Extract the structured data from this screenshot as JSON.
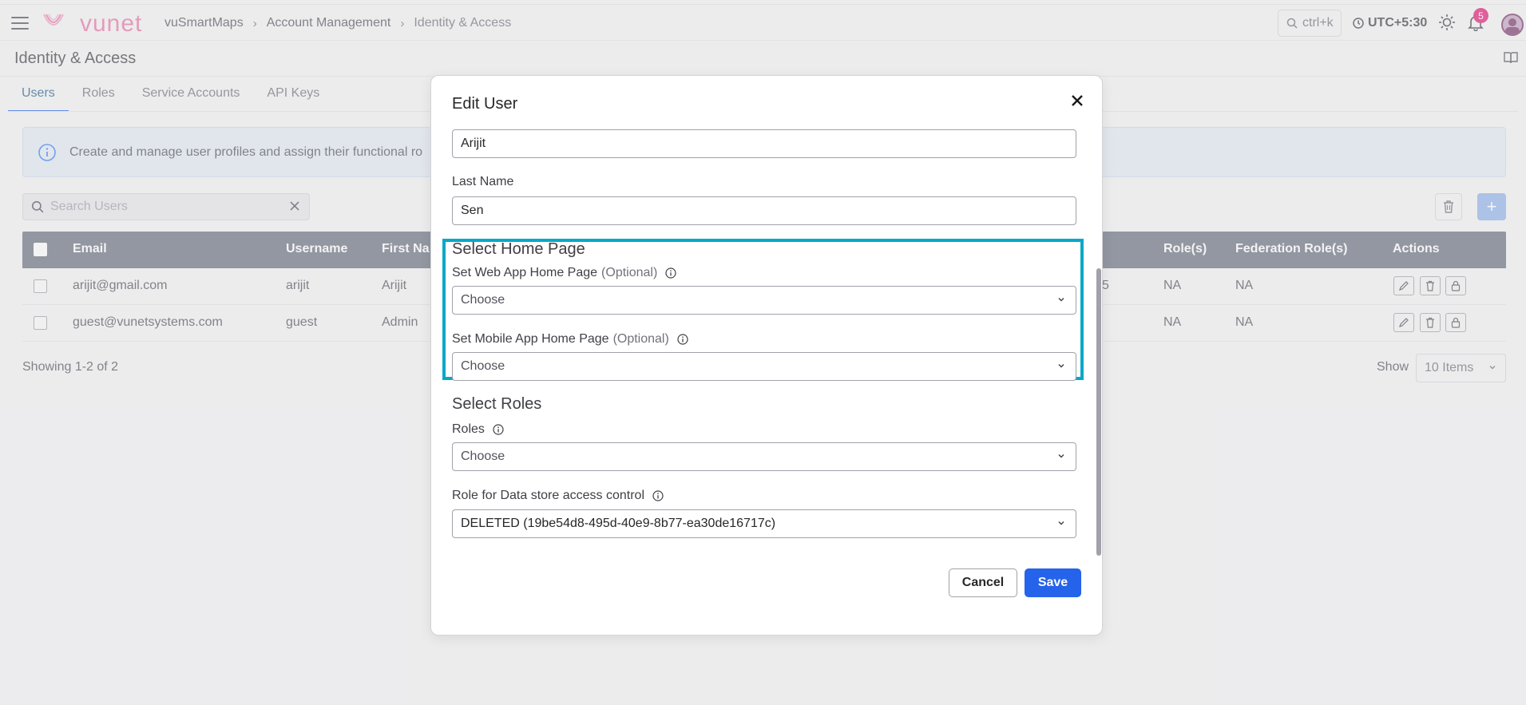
{
  "header": {
    "logo_text": "vunet",
    "breadcrumbs": [
      "vuSmartMaps",
      "Account Management",
      "Identity & Access"
    ],
    "search_shortcut": "ctrl+k",
    "timezone": "UTC+5:30",
    "notification_count": "5"
  },
  "page": {
    "title": "Identity & Access",
    "tabs": [
      "Users",
      "Roles",
      "Service Accounts",
      "API Keys"
    ],
    "active_tab": "Users",
    "info_text": "Create and manage user profiles and assign their functional ro",
    "search_placeholder": "Search Users"
  },
  "table": {
    "columns": [
      "Email",
      "Username",
      "First Na",
      "Role(s)",
      "Federation Role(s)",
      "Actions"
    ],
    "rows": [
      {
        "email": "arijit@gmail.com",
        "username": "arijit",
        "first_name": "Arijit",
        "partial": "5",
        "roles": "NA",
        "federation_roles": "NA"
      },
      {
        "email": "guest@vunetsystems.com",
        "username": "guest",
        "first_name": "Admin",
        "partial": "",
        "roles": "NA",
        "federation_roles": "NA"
      }
    ],
    "showing": "Showing 1-2 of 2",
    "show_label": "Show",
    "items_per_page": "10 Items"
  },
  "modal": {
    "title": "Edit User",
    "first_name_value": "Arijit",
    "last_name_label": "Last Name",
    "last_name_value": "Sen",
    "home_page_section": "Select Home Page",
    "web_home_label": "Set Web App Home Page",
    "mobile_home_label": "Set Mobile App Home Page",
    "optional_text": "(Optional)",
    "web_home_value": "Choose",
    "mobile_home_value": "Choose",
    "roles_section": "Select Roles",
    "roles_label": "Roles",
    "roles_value": "Choose",
    "datastore_label": "Role for Data store access control",
    "datastore_value": "DELETED (19be54d8-495d-40e9-8b77-ea30de16717c)",
    "cancel_label": "Cancel",
    "save_label": "Save"
  },
  "colors": {
    "accent": "#2563eb",
    "highlight": "#06a8c8",
    "brand": "#e879a8",
    "table_header": "#6b7280"
  }
}
